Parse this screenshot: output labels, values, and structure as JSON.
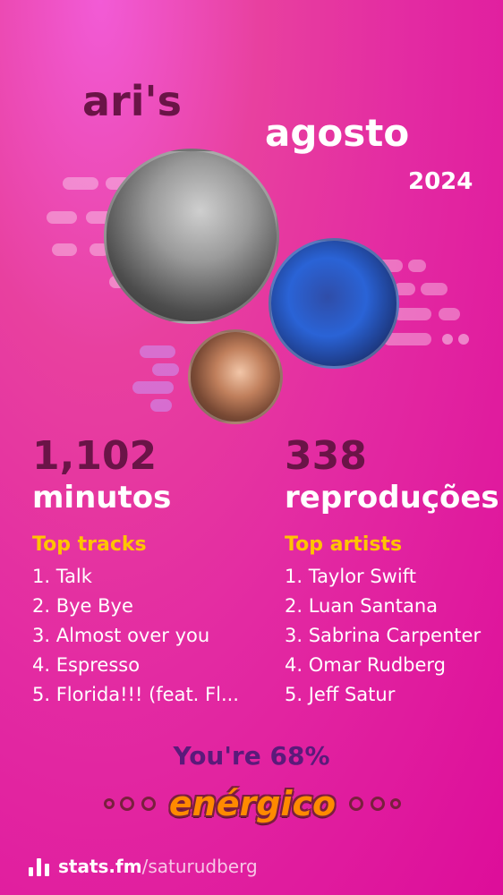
{
  "header": {
    "user": "ari's",
    "month": "agosto",
    "year": "2024"
  },
  "stats": {
    "minutes": {
      "value": "1,102",
      "label": "minutos"
    },
    "plays": {
      "value": "338",
      "label": "reproduções"
    }
  },
  "top_tracks": {
    "title": "Top tracks",
    "items": [
      "1. Talk",
      "2. Bye Bye",
      "3. Almost over you",
      "4. Espresso",
      "5. Florida!!! (feat. Fl..."
    ]
  },
  "top_artists": {
    "title": "Top artists",
    "items": [
      "1. Taylor Swift",
      "2. Luan Santana",
      "3. Sabrina Carpenter",
      "4. Omar Rudberg",
      "5. Jeff Satur"
    ]
  },
  "mood": {
    "percent_text": "You're 68%",
    "label": "enérgico"
  },
  "footer": {
    "site": "stats.fm",
    "path": "/saturudberg"
  },
  "colors": {
    "accent_yellow": "#ffc400",
    "dark_title": "#6a1447",
    "background_pink": "#e32aa2"
  }
}
